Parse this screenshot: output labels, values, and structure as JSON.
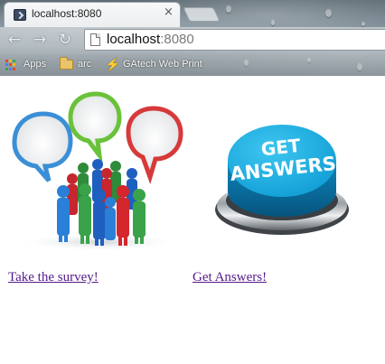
{
  "browser": {
    "tab": {
      "title": "localhost:8080",
      "close_glyph": "×"
    },
    "nav": {
      "back_glyph": "←",
      "forward_glyph": "→",
      "reload_glyph": "↻"
    },
    "address": {
      "host": "localhost",
      "port": ":8080"
    },
    "bookmarks": [
      {
        "label": "Apps",
        "icon": "apps-grid-icon"
      },
      {
        "label": "arc",
        "icon": "folder-icon"
      },
      {
        "label": "GAtech Web Print",
        "icon": "bolt-icon"
      }
    ]
  },
  "page": {
    "links": [
      {
        "label": "Take the survey!",
        "image": "survey-people-speech-bubbles"
      },
      {
        "label": "Get Answers!",
        "image": "get-answers-button"
      }
    ],
    "button_text": {
      "line1": "GET",
      "line2": "ANSWERS"
    }
  },
  "colors": {
    "link_visited": "#551a8b",
    "answers_button": "#1aa7d9",
    "bubble_blue": "#3b8fd6",
    "bubble_green": "#6ac23a",
    "bubble_red": "#d63a3a"
  }
}
